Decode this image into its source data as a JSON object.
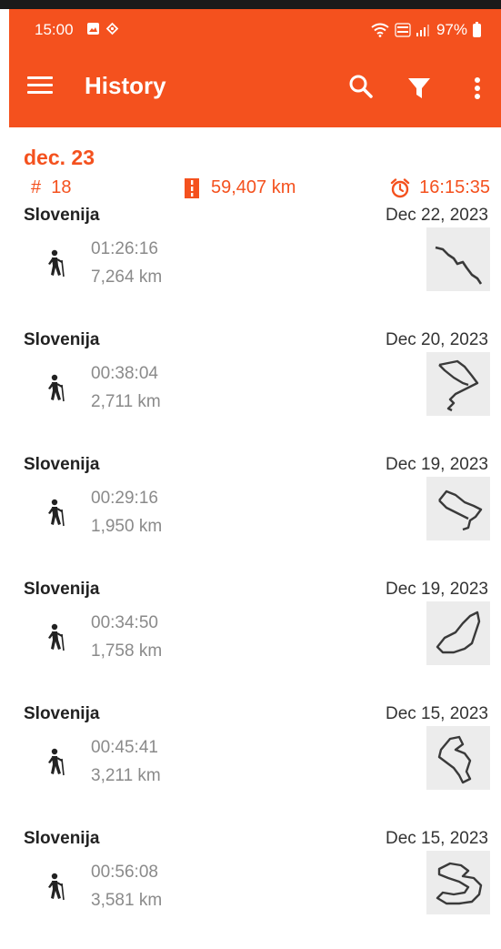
{
  "status_bar": {
    "time": "15:00",
    "battery": "97%",
    "icons": [
      "gallery-icon",
      "location-icon",
      "wifi-icon",
      "volte-icon",
      "signal-icon",
      "battery-icon"
    ]
  },
  "toolbar": {
    "title": "History",
    "color": "#f4511e",
    "actions": [
      "search-icon",
      "filter-icon",
      "more-vert-icon"
    ]
  },
  "summary": {
    "month": "dec. 23",
    "count_symbol": "#",
    "count": "18",
    "distance": "59,407 km",
    "duration": "16:15:35"
  },
  "activities": [
    {
      "place": "Slovenija",
      "date": "Dec 22, 2023",
      "duration": "01:26:16",
      "distance": "7,264 km",
      "type": "hiking"
    },
    {
      "place": "Slovenija",
      "date": "Dec 20, 2023",
      "duration": "00:38:04",
      "distance": "2,711 km",
      "type": "hiking"
    },
    {
      "place": "Slovenija",
      "date": "Dec 19, 2023",
      "duration": "00:29:16",
      "distance": "1,950 km",
      "type": "hiking"
    },
    {
      "place": "Slovenija",
      "date": "Dec 19, 2023",
      "duration": "00:34:50",
      "distance": "1,758 km",
      "type": "hiking"
    },
    {
      "place": "Slovenija",
      "date": "Dec 15, 2023",
      "duration": "00:45:41",
      "distance": "3,211 km",
      "type": "hiking"
    },
    {
      "place": "Slovenija",
      "date": "Dec 15, 2023",
      "duration": "00:56:08",
      "distance": "3,581 km",
      "type": "hiking"
    }
  ]
}
